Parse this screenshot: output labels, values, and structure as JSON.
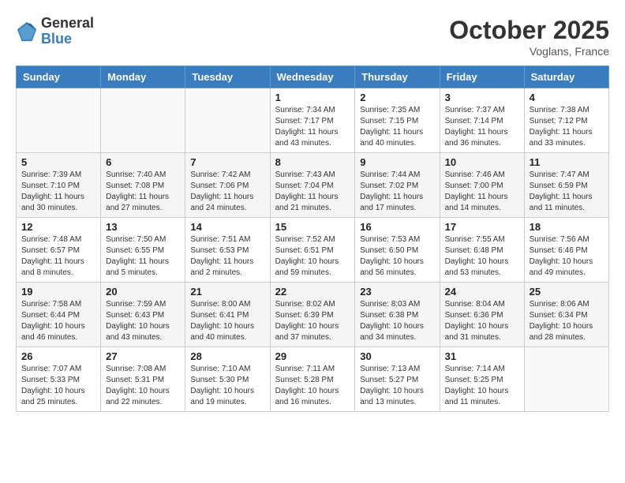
{
  "header": {
    "logo_line1": "General",
    "logo_line2": "Blue",
    "month": "October 2025",
    "location": "Voglans, France"
  },
  "weekdays": [
    "Sunday",
    "Monday",
    "Tuesday",
    "Wednesday",
    "Thursday",
    "Friday",
    "Saturday"
  ],
  "weeks": [
    [
      {
        "day": "",
        "info": ""
      },
      {
        "day": "",
        "info": ""
      },
      {
        "day": "",
        "info": ""
      },
      {
        "day": "1",
        "info": "Sunrise: 7:34 AM\nSunset: 7:17 PM\nDaylight: 11 hours\nand 43 minutes."
      },
      {
        "day": "2",
        "info": "Sunrise: 7:35 AM\nSunset: 7:15 PM\nDaylight: 11 hours\nand 40 minutes."
      },
      {
        "day": "3",
        "info": "Sunrise: 7:37 AM\nSunset: 7:14 PM\nDaylight: 11 hours\nand 36 minutes."
      },
      {
        "day": "4",
        "info": "Sunrise: 7:38 AM\nSunset: 7:12 PM\nDaylight: 11 hours\nand 33 minutes."
      }
    ],
    [
      {
        "day": "5",
        "info": "Sunrise: 7:39 AM\nSunset: 7:10 PM\nDaylight: 11 hours\nand 30 minutes."
      },
      {
        "day": "6",
        "info": "Sunrise: 7:40 AM\nSunset: 7:08 PM\nDaylight: 11 hours\nand 27 minutes."
      },
      {
        "day": "7",
        "info": "Sunrise: 7:42 AM\nSunset: 7:06 PM\nDaylight: 11 hours\nand 24 minutes."
      },
      {
        "day": "8",
        "info": "Sunrise: 7:43 AM\nSunset: 7:04 PM\nDaylight: 11 hours\nand 21 minutes."
      },
      {
        "day": "9",
        "info": "Sunrise: 7:44 AM\nSunset: 7:02 PM\nDaylight: 11 hours\nand 17 minutes."
      },
      {
        "day": "10",
        "info": "Sunrise: 7:46 AM\nSunset: 7:00 PM\nDaylight: 11 hours\nand 14 minutes."
      },
      {
        "day": "11",
        "info": "Sunrise: 7:47 AM\nSunset: 6:59 PM\nDaylight: 11 hours\nand 11 minutes."
      }
    ],
    [
      {
        "day": "12",
        "info": "Sunrise: 7:48 AM\nSunset: 6:57 PM\nDaylight: 11 hours\nand 8 minutes."
      },
      {
        "day": "13",
        "info": "Sunrise: 7:50 AM\nSunset: 6:55 PM\nDaylight: 11 hours\nand 5 minutes."
      },
      {
        "day": "14",
        "info": "Sunrise: 7:51 AM\nSunset: 6:53 PM\nDaylight: 11 hours\nand 2 minutes."
      },
      {
        "day": "15",
        "info": "Sunrise: 7:52 AM\nSunset: 6:51 PM\nDaylight: 10 hours\nand 59 minutes."
      },
      {
        "day": "16",
        "info": "Sunrise: 7:53 AM\nSunset: 6:50 PM\nDaylight: 10 hours\nand 56 minutes."
      },
      {
        "day": "17",
        "info": "Sunrise: 7:55 AM\nSunset: 6:48 PM\nDaylight: 10 hours\nand 53 minutes."
      },
      {
        "day": "18",
        "info": "Sunrise: 7:56 AM\nSunset: 6:46 PM\nDaylight: 10 hours\nand 49 minutes."
      }
    ],
    [
      {
        "day": "19",
        "info": "Sunrise: 7:58 AM\nSunset: 6:44 PM\nDaylight: 10 hours\nand 46 minutes."
      },
      {
        "day": "20",
        "info": "Sunrise: 7:59 AM\nSunset: 6:43 PM\nDaylight: 10 hours\nand 43 minutes."
      },
      {
        "day": "21",
        "info": "Sunrise: 8:00 AM\nSunset: 6:41 PM\nDaylight: 10 hours\nand 40 minutes."
      },
      {
        "day": "22",
        "info": "Sunrise: 8:02 AM\nSunset: 6:39 PM\nDaylight: 10 hours\nand 37 minutes."
      },
      {
        "day": "23",
        "info": "Sunrise: 8:03 AM\nSunset: 6:38 PM\nDaylight: 10 hours\nand 34 minutes."
      },
      {
        "day": "24",
        "info": "Sunrise: 8:04 AM\nSunset: 6:36 PM\nDaylight: 10 hours\nand 31 minutes."
      },
      {
        "day": "25",
        "info": "Sunrise: 8:06 AM\nSunset: 6:34 PM\nDaylight: 10 hours\nand 28 minutes."
      }
    ],
    [
      {
        "day": "26",
        "info": "Sunrise: 7:07 AM\nSunset: 5:33 PM\nDaylight: 10 hours\nand 25 minutes."
      },
      {
        "day": "27",
        "info": "Sunrise: 7:08 AM\nSunset: 5:31 PM\nDaylight: 10 hours\nand 22 minutes."
      },
      {
        "day": "28",
        "info": "Sunrise: 7:10 AM\nSunset: 5:30 PM\nDaylight: 10 hours\nand 19 minutes."
      },
      {
        "day": "29",
        "info": "Sunrise: 7:11 AM\nSunset: 5:28 PM\nDaylight: 10 hours\nand 16 minutes."
      },
      {
        "day": "30",
        "info": "Sunrise: 7:13 AM\nSunset: 5:27 PM\nDaylight: 10 hours\nand 13 minutes."
      },
      {
        "day": "31",
        "info": "Sunrise: 7:14 AM\nSunset: 5:25 PM\nDaylight: 10 hours\nand 11 minutes."
      },
      {
        "day": "",
        "info": ""
      }
    ]
  ]
}
